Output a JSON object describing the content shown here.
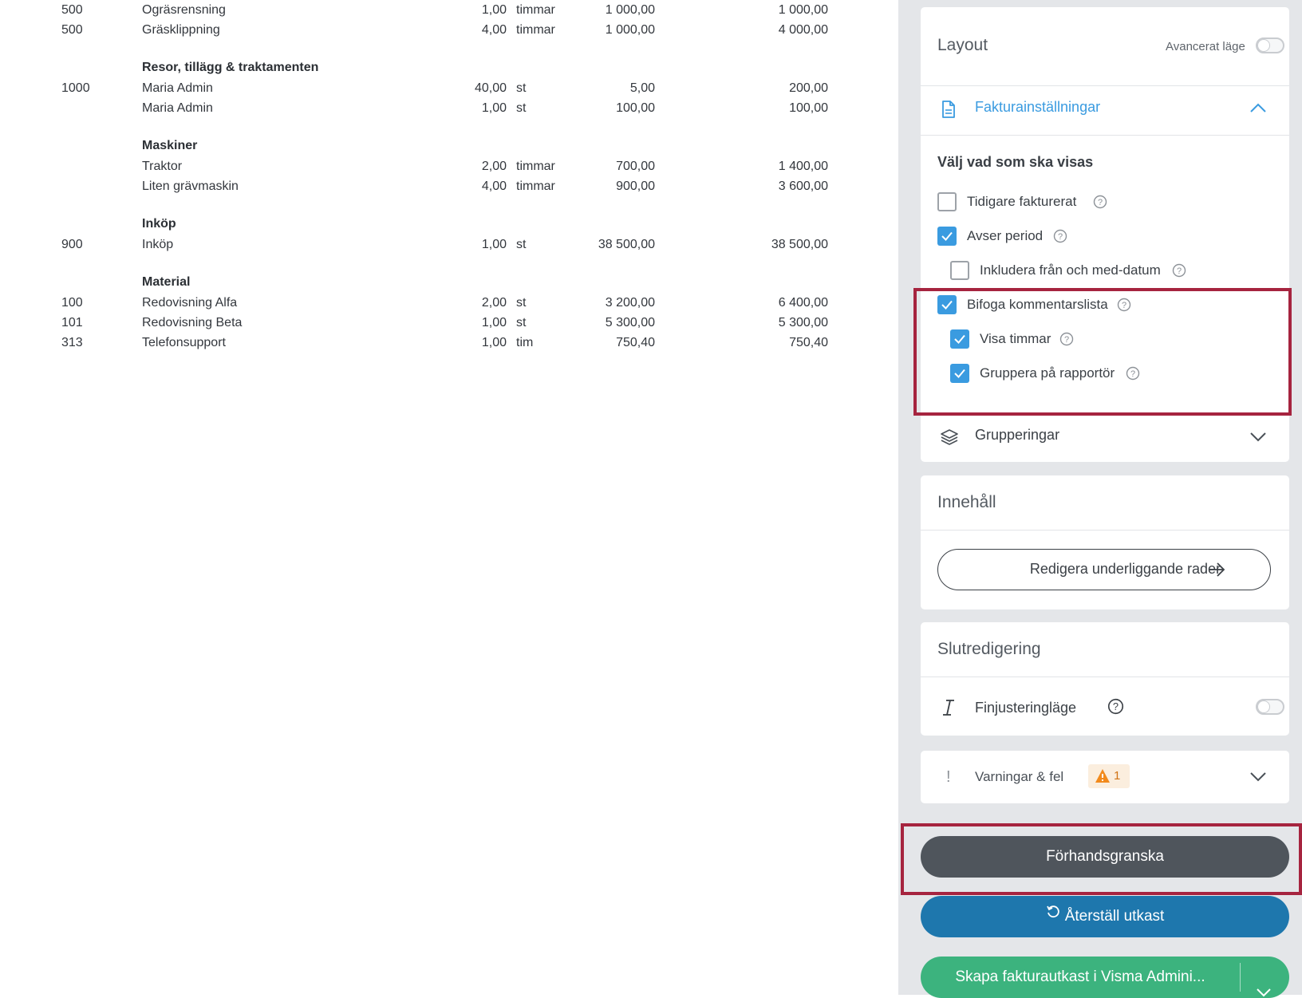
{
  "invoice": {
    "rows": [
      {
        "code": "500",
        "desc": "Ogräsrensning",
        "qty": "1,00",
        "unit": "timmar",
        "price": "1 000,00",
        "total": "1 000,00"
      },
      {
        "code": "500",
        "desc": "Gräsklippning",
        "qty": "4,00",
        "unit": "timmar",
        "price": "1 000,00",
        "total": "4 000,00"
      },
      {
        "group": "Resor, tillägg & traktamenten"
      },
      {
        "code": "1000",
        "desc": "Maria Admin",
        "qty": "40,00",
        "unit": "st",
        "price": "5,00",
        "total": "200,00"
      },
      {
        "code": "",
        "desc": "Maria Admin",
        "qty": "1,00",
        "unit": "st",
        "price": "100,00",
        "total": "100,00"
      },
      {
        "group": "Maskiner"
      },
      {
        "code": "",
        "desc": "Traktor",
        "qty": "2,00",
        "unit": "timmar",
        "price": "700,00",
        "total": "1 400,00"
      },
      {
        "code": "",
        "desc": "Liten grävmaskin",
        "qty": "4,00",
        "unit": "timmar",
        "price": "900,00",
        "total": "3 600,00"
      },
      {
        "group": "Inköp"
      },
      {
        "code": "900",
        "desc": "Inköp",
        "qty": "1,00",
        "unit": "st",
        "price": "38 500,00",
        "total": "38 500,00"
      },
      {
        "group": "Material"
      },
      {
        "code": "100",
        "desc": "Redovisning Alfa",
        "qty": "2,00",
        "unit": "st",
        "price": "3 200,00",
        "total": "6 400,00"
      },
      {
        "code": "101",
        "desc": "Redovisning Beta",
        "qty": "1,00",
        "unit": "st",
        "price": "5 300,00",
        "total": "5 300,00"
      },
      {
        "code": "313",
        "desc": "Telefonsupport",
        "qty": "1,00",
        "unit": "tim",
        "price": "750,40",
        "total": "750,40"
      }
    ]
  },
  "layout_card": {
    "title": "Layout",
    "advanced_label": "Avancerat läge",
    "advanced_on": false,
    "invoice_settings": {
      "label": "Fakturainställningar",
      "icon": "document-icon",
      "expanded": true
    },
    "choose_heading": "Välj vad som ska visas",
    "options": {
      "previously_invoiced": {
        "label": "Tidigare fakturerat",
        "checked": false
      },
      "period": {
        "label": "Avser period",
        "checked": true
      },
      "include_dates": {
        "label": "Inkludera från och med-datum",
        "checked": false
      },
      "comment_list": {
        "label": "Bifoga kommentarslista",
        "checked": true
      },
      "show_hours": {
        "label": "Visa timmar",
        "checked": true
      },
      "group_by_reporter": {
        "label": "Gruppera på rapportör",
        "checked": true
      }
    },
    "groupings": {
      "label": "Grupperingar",
      "icon": "layers-icon",
      "expanded": false
    }
  },
  "content_card": {
    "title": "Innehåll",
    "edit_button": "Redigera underliggande rader"
  },
  "final_card": {
    "title": "Slutredigering",
    "finetune_label": "Finjusteringläge",
    "finetune_on": false
  },
  "warnings_card": {
    "label": "Varningar & fel",
    "badge_count": "1",
    "expanded": false
  },
  "actions": {
    "preview": "Förhandsgranska",
    "reset": "Återställ utkast",
    "create": "Skapa fakturautkast i Visma Admini..."
  },
  "colors": {
    "accent_blue": "#3a9be0",
    "preview_button": "#4f555c",
    "reset_button": "#1e77ad",
    "create_button": "#3cb37e",
    "highlight": "#a6243f",
    "warning": "#f28a1c"
  }
}
